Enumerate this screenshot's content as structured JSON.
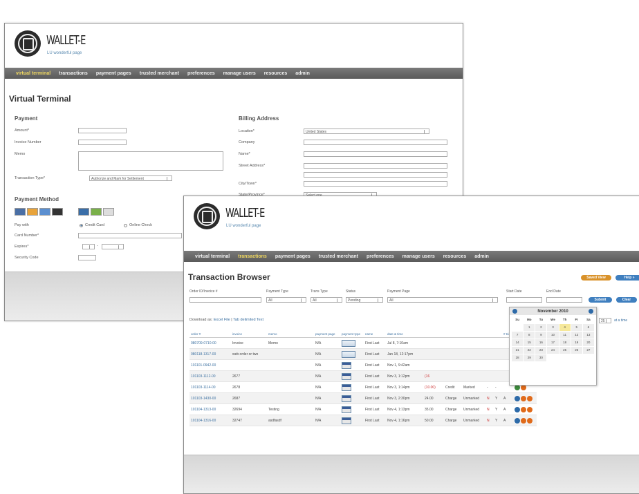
{
  "brand": {
    "name": "WALLET-E",
    "tagline": "LU wonderful page"
  },
  "nav": [
    "virtual terminal",
    "transactions",
    "payment pages",
    "trusted merchant",
    "preferences",
    "manage users",
    "resources",
    "admin"
  ],
  "back_window": {
    "page_title": "Virtual Terminal",
    "payment": {
      "heading": "Payment",
      "amount_label": "Amount*",
      "invoice_label": "Invoice Number",
      "memo_label": "Memo",
      "transaction_type_label": "Transaction Type*",
      "transaction_type_value": "Authorize and Mark for Settlement"
    },
    "billing": {
      "heading": "Billing Address",
      "location_label": "Location*",
      "location_value": "United States",
      "company_label": "Company",
      "name_label": "Name*",
      "street_label": "Street Address*",
      "city_label": "City/Town*",
      "state_label": "State/Province*",
      "state_value": "Select one"
    },
    "payment_method": {
      "heading": "Payment Method",
      "pay_with_label": "Pay with",
      "credit_card": "Credit Card",
      "online_check": "Online Check",
      "card_number_label": "Card Number*",
      "expires_label": "Expires*",
      "security_code_label": "Security Code"
    }
  },
  "front_window": {
    "page_title": "Transaction Browser",
    "buttons": {
      "saved_views": "Saved View",
      "help": "Help »",
      "submit": "Submit",
      "clear": "Clear"
    },
    "filters": {
      "order_id_label": "Order ID/Invoice #",
      "payment_type_label": "Payment Type",
      "payment_type_value": "All",
      "trans_type_label": "Trans Type",
      "trans_type_value": "All",
      "status_label": "Status",
      "status_value": "Pending",
      "payment_page_label": "Payment Page",
      "payment_page_value": "All",
      "start_date_label": "Start Date",
      "end_date_label": "End Date",
      "per_page": "25",
      "per_page_suffix": "at a time"
    },
    "download": {
      "label": "Download as:",
      "excel": "Excel File",
      "tab": "Tab delimited Text"
    },
    "table": {
      "columns": [
        "order #",
        "invoice",
        "memo",
        "payment page",
        "payment type",
        "name",
        "date & time",
        "",
        "",
        "",
        "",
        "",
        "# tries",
        ""
      ],
      "rows": [
        {
          "order": "080709-0710-00",
          "invoice": "Invoice",
          "memo": "Memo",
          "page": "N/A",
          "type": "check",
          "name": "First Last",
          "date": "Jul 8, 7:10am",
          "amount": "",
          "trans": "",
          "status": "",
          "f1": "",
          "f2": "",
          "tries": "",
          "actions": [
            "o",
            "o"
          ]
        },
        {
          "order": "080118-1317-00",
          "invoice": "web order or two",
          "memo": "",
          "page": "N/A",
          "type": "check",
          "name": "First Last",
          "date": "Jan 18, 12:17pm",
          "amount": "",
          "trans": "",
          "status": "",
          "f1": "",
          "f2": "",
          "tries": "",
          "actions": [
            "o",
            "o"
          ]
        },
        {
          "order": "101101-0942-00",
          "invoice": "",
          "memo": "",
          "page": "N/A",
          "type": "card",
          "name": "First Last",
          "date": "Nov 1, 9:42am",
          "amount": "",
          "trans": "",
          "status": "",
          "f1": "",
          "f2": "",
          "tries": "",
          "actions": [
            "b",
            "o",
            "o"
          ]
        },
        {
          "order": "101103-1112-00",
          "invoice": "2677",
          "memo": "",
          "page": "N/A",
          "type": "card",
          "name": "First Last",
          "date": "Nov 3, 1:12pm",
          "amount": "(16",
          "trans": "",
          "status": "",
          "f1": "",
          "f2": "",
          "tries": "",
          "actions": [
            "g",
            "o"
          ]
        },
        {
          "order": "101103-1114-00",
          "invoice": "2678",
          "memo": "",
          "page": "N/A",
          "type": "card",
          "name": "First Last",
          "date": "Nov 3, 1:14pm",
          "amount": "(10.00)",
          "trans": "Credit",
          "status": "Marked",
          "f1": "-",
          "f2": "-",
          "tries": "",
          "actions": [
            "g",
            "o"
          ]
        },
        {
          "order": "101103-1430-00",
          "invoice": "2687",
          "memo": "",
          "page": "N/A",
          "type": "card",
          "name": "First Last",
          "date": "Nov 3, 2:30pm",
          "amount": "24.00",
          "trans": "Charge",
          "status": "Unmarked",
          "f1": "N",
          "f2": "Y",
          "tries": "A",
          "actions": [
            "b",
            "o",
            "o"
          ]
        },
        {
          "order": "101104-1313-00",
          "invoice": "32694",
          "memo": "Testing",
          "page": "N/A",
          "type": "card",
          "name": "First Last",
          "date": "Nov 4, 1:13pm",
          "amount": "35.00",
          "trans": "Charge",
          "status": "Unmarked",
          "f1": "N",
          "f2": "Y",
          "tries": "A",
          "actions": [
            "b",
            "o",
            "o"
          ]
        },
        {
          "order": "101104-1316-00",
          "invoice": "32747",
          "memo": "asdfasdf",
          "page": "N/A",
          "type": "card",
          "name": "First Last",
          "date": "Nov 4, 1:16pm",
          "amount": "50.00",
          "trans": "Charge",
          "status": "Unmarked",
          "f1": "N",
          "f2": "Y",
          "tries": "A",
          "actions": [
            "b",
            "o",
            "o"
          ]
        }
      ]
    },
    "calendar": {
      "month": "November 2010",
      "days_of_week": [
        "Su",
        "Mo",
        "Tu",
        "We",
        "Th",
        "Fr",
        "Sa"
      ],
      "weeks": [
        [
          "",
          "1",
          "2",
          "3",
          "4",
          "5",
          "6"
        ],
        [
          "7",
          "8",
          "9",
          "10",
          "11",
          "12",
          "13"
        ],
        [
          "14",
          "15",
          "16",
          "17",
          "18",
          "19",
          "20"
        ],
        [
          "21",
          "22",
          "23",
          "24",
          "25",
          "26",
          "27"
        ],
        [
          "28",
          "29",
          "30",
          "",
          "",
          "",
          ""
        ]
      ],
      "today": "4"
    }
  }
}
